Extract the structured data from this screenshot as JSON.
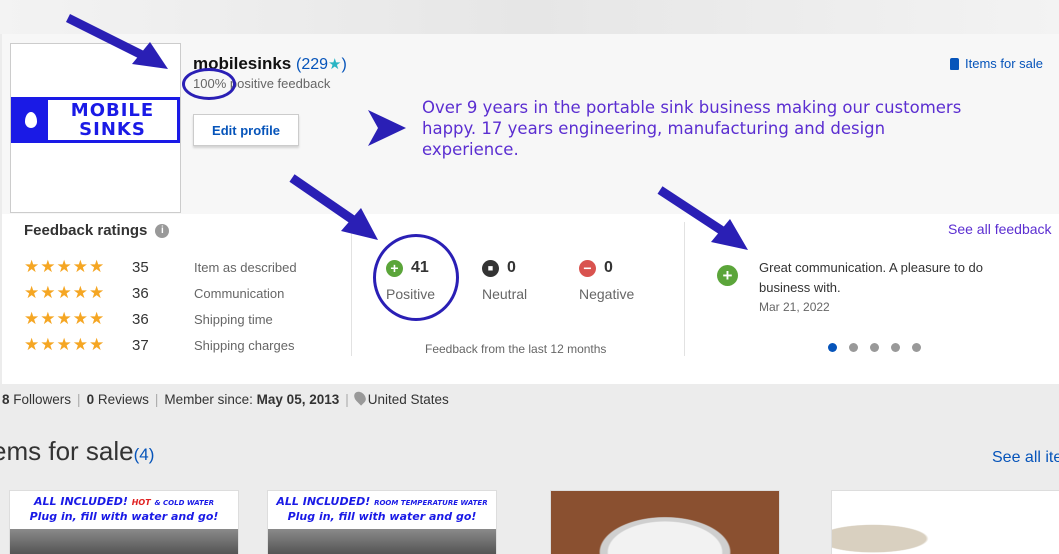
{
  "seller": {
    "name": "mobilesinks",
    "score_open": "(",
    "score": "229",
    "score_star": "★",
    "score_close": ")",
    "positive_feedback": "100% positive feedback",
    "edit_profile_label": "Edit profile",
    "items_for_sale_link": "Items for sale",
    "logo_text_line1": "MOBILE",
    "logo_text_line2": "SINKS",
    "about": "Over 9 years in the portable sink business making our customers happy. 17 years engineering, manufacturing and design experience."
  },
  "feedback_ratings": {
    "title": "Feedback ratings",
    "info_icon": "i",
    "rows": [
      {
        "stars": "★★★★★",
        "count": "35",
        "label": "Item as described"
      },
      {
        "stars": "★★★★★",
        "count": "36",
        "label": "Communication"
      },
      {
        "stars": "★★★★★",
        "count": "36",
        "label": "Shipping time"
      },
      {
        "stars": "★★★★★",
        "count": "37",
        "label": "Shipping charges"
      }
    ]
  },
  "feedback_summary": {
    "positive": {
      "count": "41",
      "label": "Positive",
      "icon": "+",
      "color": "#5ba53a"
    },
    "neutral": {
      "count": "0",
      "label": "Neutral",
      "icon": "■",
      "color": "#333333"
    },
    "negative": {
      "count": "0",
      "label": "Negative",
      "icon": "−",
      "color": "#d9534f"
    },
    "period": "Feedback from the last 12 months"
  },
  "recent_feedback": {
    "see_all": "See all feedback",
    "icon": "+",
    "comment": "Great communication. A pleasure to do business with.",
    "date": "Mar 21, 2022",
    "dots_total": 5,
    "active_dot": 1
  },
  "meta": {
    "followers_count": "8",
    "followers_label": "Followers",
    "reviews_count": "0",
    "reviews_label": "Reviews",
    "member_since_label": "Member since:",
    "member_since_date": "May 05, 2013",
    "location": "United States",
    "separator": "|"
  },
  "items_section": {
    "heading": "ems for sale",
    "count": "(4)",
    "see_all": "See all ite",
    "cards": [
      {
        "banner_a": "ALL INCLUDED!",
        "banner_hot": "HOT",
        "banner_tail": "& COLD WATER",
        "banner_2": "Plug in, fill with water and go!"
      },
      {
        "banner_a": "ALL INCLUDED!",
        "banner_small": "ROOM TEMPERATURE WATER",
        "banner_2": "Plug in, fill with water and go!"
      }
    ]
  },
  "colors": {
    "link": "#0654ba",
    "annotation": "#2a1fb5",
    "blurb": "#5b2ed1",
    "star": "#f5a623"
  }
}
